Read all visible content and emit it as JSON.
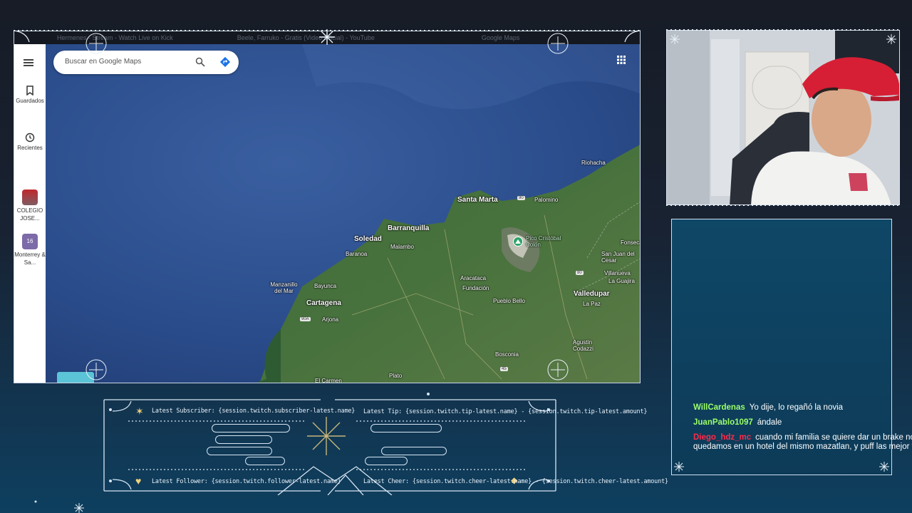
{
  "browser": {
    "tabs": [
      "Hermenes - Stream - Watch Live on Kick",
      "Beele, Farruko - Gratis (Video Oficial) - YouTube",
      "Google Maps"
    ]
  },
  "maps": {
    "search_placeholder": "Buscar en Google Maps",
    "sidebar": [
      {
        "label": "Guardados",
        "icon": "bookmark-icon"
      },
      {
        "label": "Recientes",
        "icon": "history-icon"
      },
      {
        "label": "COLEGIO JOSE...",
        "icon": "school-thumbnail"
      },
      {
        "label": "Monterrey & Sa...",
        "icon": "calendar-thumbnail"
      }
    ],
    "places": [
      {
        "name": "Riohacha",
        "size": "small"
      },
      {
        "name": "Palomino",
        "size": "small"
      },
      {
        "name": "Santa Marta",
        "size": "big"
      },
      {
        "name": "Barranquilla",
        "size": "big"
      },
      {
        "name": "Soledad",
        "size": "big"
      },
      {
        "name": "Malambo",
        "size": "small"
      },
      {
        "name": "Baranoa",
        "size": "small"
      },
      {
        "name": "Pico Cristóbal Colón",
        "size": "peak"
      },
      {
        "name": "Fonseca",
        "size": "small"
      },
      {
        "name": "San Juan del Cesar",
        "size": "small"
      },
      {
        "name": "Villanueva",
        "size": "small"
      },
      {
        "name": "La Guajira",
        "size": "small"
      },
      {
        "name": "Aracataca",
        "size": "small"
      },
      {
        "name": "Fundación",
        "size": "small"
      },
      {
        "name": "Manzanillo del Mar",
        "size": "small"
      },
      {
        "name": "Bayunca",
        "size": "small"
      },
      {
        "name": "Cartagena",
        "size": "big"
      },
      {
        "name": "Arjona",
        "size": "small"
      },
      {
        "name": "Valledupar",
        "size": "big"
      },
      {
        "name": "La Paz",
        "size": "small"
      },
      {
        "name": "Pueblo Bello",
        "size": "small"
      },
      {
        "name": "Agustín Codazzi",
        "size": "small"
      },
      {
        "name": "Bosconia",
        "size": "small"
      },
      {
        "name": "El Carmen",
        "size": "small"
      },
      {
        "name": "Plato",
        "size": "small"
      }
    ],
    "highways": [
      "90",
      "90A",
      "80",
      "45"
    ]
  },
  "overlay": {
    "latest_subscriber": "Latest Subscriber: {session.twitch.subscriber-latest.name}",
    "latest_tip": "Latest Tip: {session.twitch.tip-latest.name} - {session.twitch.tip-latest.amount}",
    "latest_follower": "Latest Follower: {session.twitch.follower-latest.name}",
    "latest_cheer": "Latest Cheer: {session.twitch.cheer-latest.name} - {session.twitch.cheer-latest.amount}"
  },
  "chat": {
    "messages": [
      {
        "user": "WillCardenas",
        "color": "#9cff6a",
        "text": "Yo dije, lo regañó la novia"
      },
      {
        "user": "JuanPablo1097",
        "color": "#9cff6a",
        "text": "ándale"
      },
      {
        "user": "Diego_hdz_mc",
        "color": "#ff2a4a",
        "text": "cuando mi familia se quiere dar un brake nos quedamos en un hotel del mismo mazatlan, y puff las mejor todo"
      }
    ]
  },
  "colors": {
    "accent": "#d7e6f3",
    "chat_bg": "#0f4767",
    "page_bg": "#171c26"
  }
}
